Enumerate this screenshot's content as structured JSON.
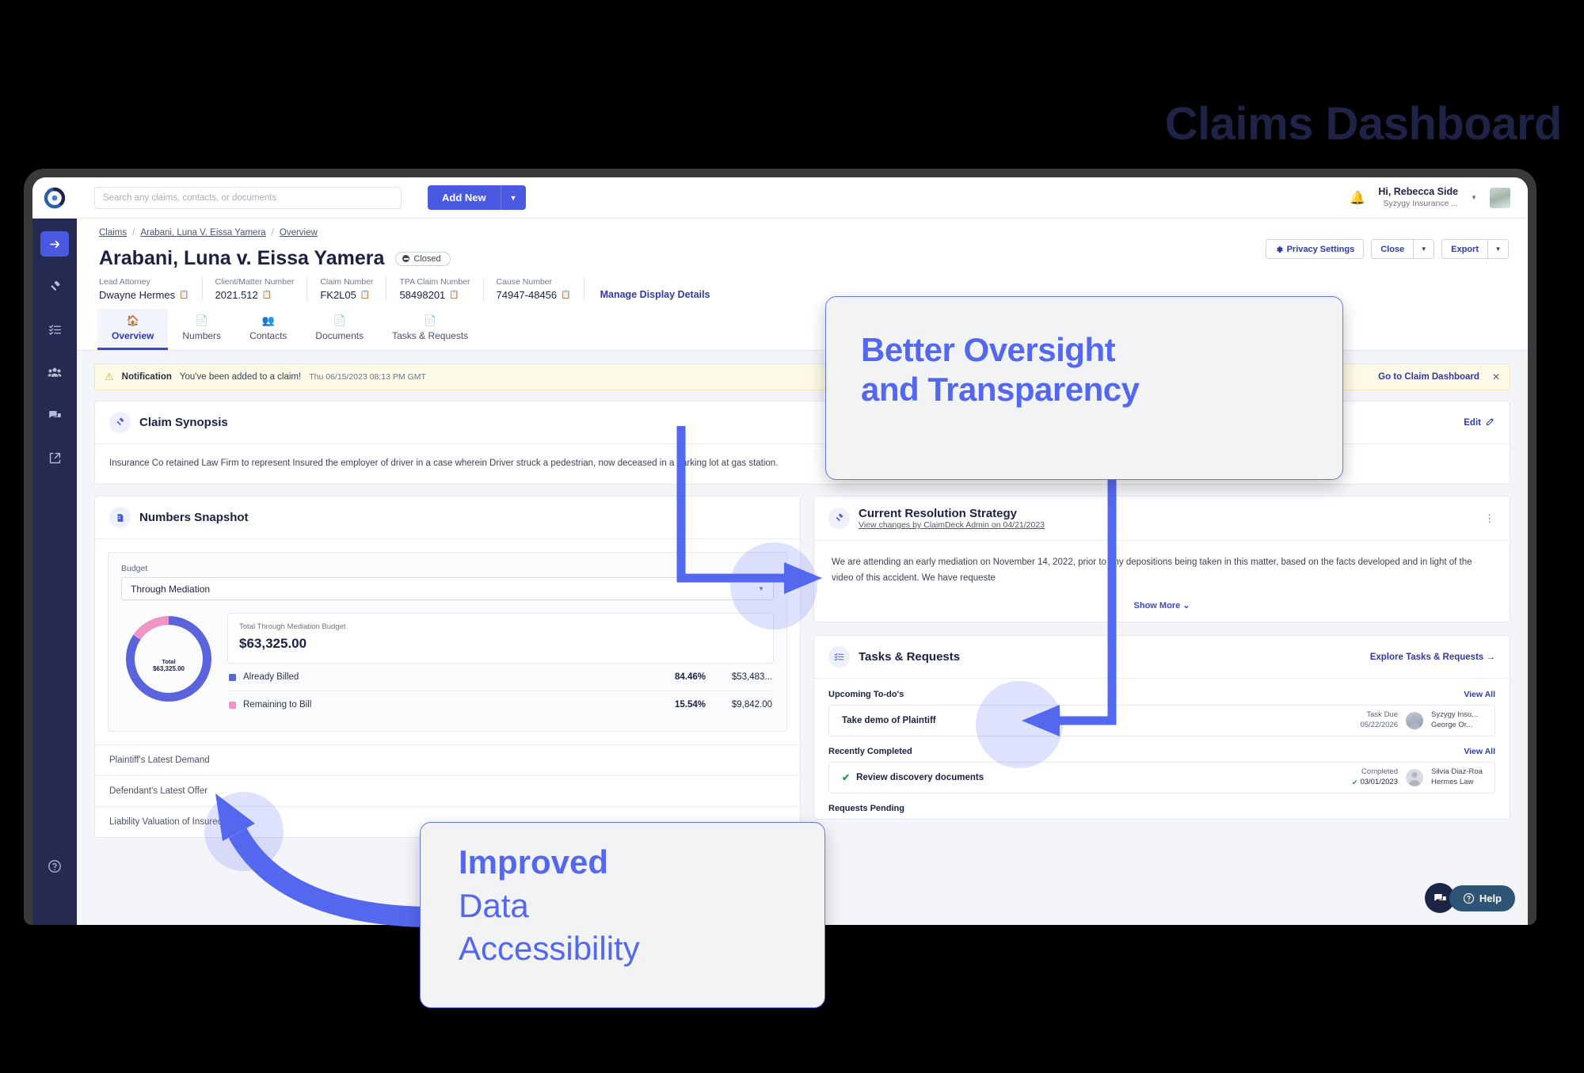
{
  "hero": {
    "title": "Claims Dashboard"
  },
  "topbar": {
    "logo_icon": "claimdeck-logo-icon",
    "search_placeholder": "Search any claims, contacts, or documents",
    "search_value": "",
    "add_new_label": "Add New",
    "bell_icon": "notification-bell-icon",
    "user_greeting": "Hi, Rebecca  Side",
    "user_org": "Syzygy Insurance ...",
    "avatar_icon": "user-avatar"
  },
  "sidebar": {
    "items": [
      {
        "icon": "arrow-right-icon",
        "name": "expand-sidebar",
        "active": true
      },
      {
        "icon": "gavel-icon",
        "name": "claims",
        "active": false
      },
      {
        "icon": "checklist-icon",
        "name": "tasks",
        "active": false
      },
      {
        "icon": "people-icon",
        "name": "contacts",
        "active": false
      },
      {
        "icon": "chat-bubbles-icon",
        "name": "messages",
        "active": false
      },
      {
        "icon": "share-icon",
        "name": "share",
        "active": false
      }
    ],
    "help_icon": "help-circle-icon"
  },
  "breadcrumb": {
    "items": [
      "Claims",
      "Arabani, Luna V. Eissa Yamera",
      "Overview"
    ],
    "separator": "/"
  },
  "header_actions": {
    "privacy_label": "Privacy Settings",
    "privacy_icon": "gear-icon",
    "close_label": "Close",
    "export_label": "Export"
  },
  "claim": {
    "title": "Arabani, Luna v. Eissa Yamera",
    "status": "Closed",
    "manage_link": "Manage Display Details",
    "meta": [
      {
        "label": "Lead Attorney",
        "value": "Dwayne Hermes"
      },
      {
        "label": "Client/Matter Number",
        "value": "2021.512"
      },
      {
        "label": "Claim Number",
        "value": "FK2L05"
      },
      {
        "label": "TPA Claim Number",
        "value": "58498201"
      },
      {
        "label": "Cause Number",
        "value": "74947-48456"
      }
    ]
  },
  "tabs": [
    {
      "label": "Overview",
      "icon": "home-icon",
      "active": true
    },
    {
      "label": "Numbers",
      "icon": "document-icon",
      "active": false
    },
    {
      "label": "Contacts",
      "icon": "people-icon",
      "active": false
    },
    {
      "label": "Documents",
      "icon": "document-icon",
      "active": false
    },
    {
      "label": "Tasks & Requests",
      "icon": "document-icon",
      "active": false
    }
  ],
  "notification": {
    "warn_icon": "warning-triangle-icon",
    "title": "Notification",
    "message": "You've been added to a claim!",
    "timestamp": "Thu 06/15/2023 08:13 PM GMT",
    "link": "Go to Claim Dashboard",
    "close_icon": "close-icon"
  },
  "synopsis": {
    "icon": "gavel-icon",
    "title": "Claim Synopsis",
    "edit_label": "Edit",
    "edit_icon": "edit-pencil-icon",
    "body": "Insurance Co retained Law Firm to represent Insured the employer of driver in a case wherein Driver struck a pedestrian, now deceased in a parking lot at gas station."
  },
  "numbers_snapshot": {
    "icon": "document-icon",
    "title": "Numbers Snapshot",
    "budget_label": "Budget",
    "budget_selected": "Through Mediation",
    "total_label": "Total Through Mediation Budget",
    "total_value": "$63,325.00",
    "donut_center_line1": "Total",
    "donut_center_line2": "$63,325.00",
    "rows": [
      {
        "label": "Plaintiff's Latest Demand",
        "value": ""
      },
      {
        "label": "Defendant's Latest Offer",
        "value": ""
      },
      {
        "label": "Liability Valuation of Insured(s)",
        "value": ""
      }
    ]
  },
  "chart_data": {
    "type": "pie",
    "title": "Total Through Mediation Budget",
    "center_label": "Total",
    "center_value": "$63,325.00",
    "total": 63325.0,
    "categories": [
      "Already Billed",
      "Remaining to Bill"
    ],
    "values": [
      53483.0,
      9842.0
    ],
    "percentages": [
      84.46,
      15.54
    ],
    "percent_labels": [
      "84.46%",
      "15.54%"
    ],
    "value_labels": [
      "$53,483...",
      "$9,842.00"
    ],
    "colors": [
      "#5b63dd",
      "#ef94c4"
    ],
    "legend": "bottom"
  },
  "strategy": {
    "icon": "gavel-icon",
    "title": "Current Resolution Strategy",
    "subtitle": "View changes by ClaimDeck Admin on 04/21/2023",
    "kebab_icon": "kebab-menu-icon",
    "body": "We are attending an early mediation on November 14, 2022, prior to any depositions being taken in this matter, based on the facts developed and in light of the video of this accident. We have requeste",
    "show_more": "Show More"
  },
  "tasks": {
    "icon": "checklist-icon",
    "title": "Tasks & Requests",
    "explore_link": "Explore Tasks & Requests",
    "sections": [
      {
        "heading": "Upcoming To-do's",
        "view_all": "View All",
        "items": [
          {
            "name": "Take demo of Plaintiff",
            "date_label": "Task Due",
            "date": "05/22/2026",
            "org": "Syzygy Insu...",
            "person": "George Or...",
            "completed": false
          }
        ]
      },
      {
        "heading": "Recently Completed",
        "view_all": "View All",
        "items": [
          {
            "name": "Review discovery documents",
            "date_label": "Completed",
            "date": "03/01/2023",
            "org": "Silvia Diaz-Roa",
            "person": "Hermes Law",
            "completed": true
          }
        ]
      },
      {
        "heading": "Requests Pending",
        "view_all": "",
        "items": []
      }
    ]
  },
  "widgets": {
    "chat_icon": "chat-bubbles-icon",
    "help_label": "Help",
    "help_icon": "help-circle-icon"
  },
  "callouts": [
    {
      "line1": "Better Oversight",
      "line2": "and Transparency"
    },
    {
      "line1": "Improved",
      "line2": "Data",
      "line3": "Accessibility"
    }
  ],
  "colors": {
    "accent": "#5468ef",
    "brand_blue": "#4a5ae0",
    "navy": "#242a52",
    "pink": "#ef94c4",
    "link": "#2f3aa8"
  }
}
